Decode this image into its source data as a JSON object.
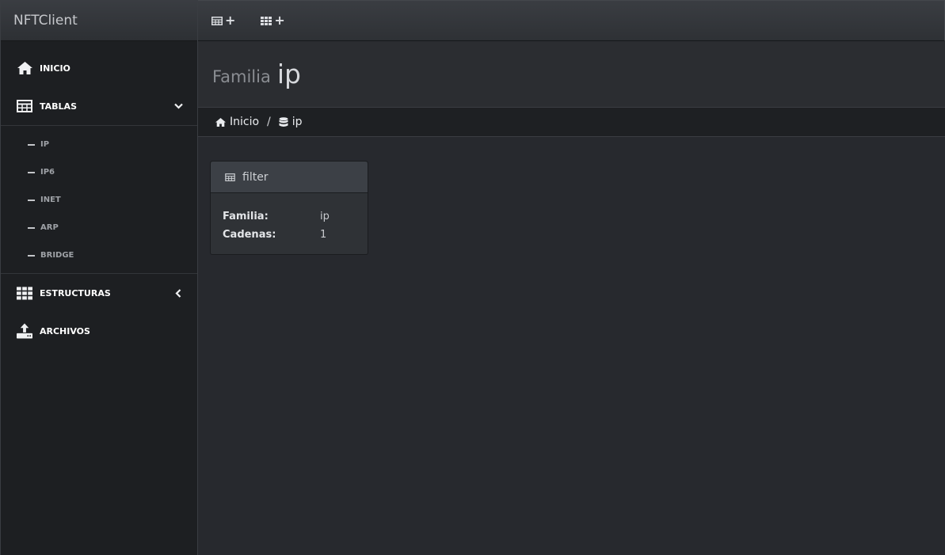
{
  "brand": "NFTClient",
  "sidebar": {
    "items": [
      {
        "label": "INICIO",
        "icon": "home-icon"
      },
      {
        "label": "TABLAS",
        "icon": "table-icon"
      },
      {
        "label": "ESTRUCTURAS",
        "icon": "grid-icon"
      },
      {
        "label": "ARCHIVOS",
        "icon": "upload-icon"
      }
    ],
    "tablas_sub": [
      "IP",
      "IP6",
      "INET",
      "ARP",
      "BRIDGE"
    ]
  },
  "topbar": {
    "buttons": [
      {
        "icon": "table-add-icon",
        "plus": "+"
      },
      {
        "icon": "grid-add-icon",
        "plus": "+"
      }
    ]
  },
  "header": {
    "subtitle": "Familia",
    "title": "ip"
  },
  "breadcrumb": {
    "home": "Inicio",
    "separator": "/",
    "current": "ip"
  },
  "panel": {
    "title": "filter",
    "rows": [
      {
        "key": "Familia:",
        "value": "ip"
      },
      {
        "key": "Cadenas:",
        "value": "1"
      }
    ]
  },
  "colors": {
    "background": "#27292e",
    "sidebar": "#1d1f22",
    "panel_head": "#3c4046"
  }
}
